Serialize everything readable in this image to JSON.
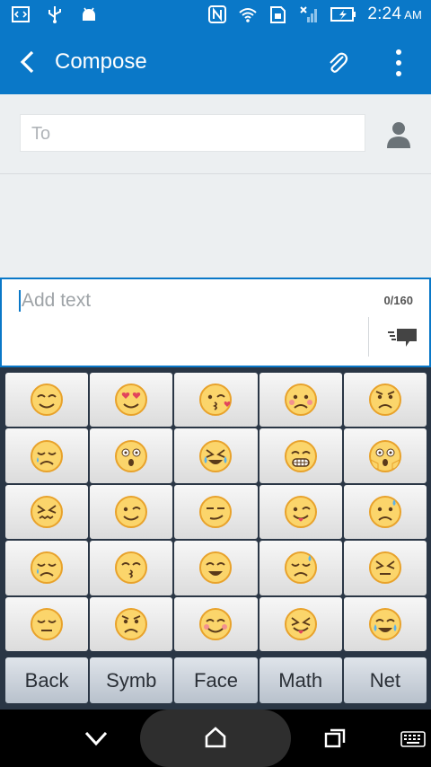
{
  "status_bar": {
    "time": "2:24",
    "ampm": "AM"
  },
  "app_bar": {
    "title": "Compose"
  },
  "to_field": {
    "placeholder": "To"
  },
  "message": {
    "placeholder": "Add text",
    "counter": "0/160"
  },
  "emoji_names": [
    "smiling-face",
    "heart-eyes-face",
    "kissing-heart-face",
    "flushed-worried-face",
    "angry-face",
    "sad-tear-face",
    "surprised-face",
    "crying-face",
    "grinning-teeth-face",
    "screaming-face",
    "confounded-face",
    "winking-face",
    "smirking-face",
    "wink-tongue-face",
    "worried-face",
    "disappointed-relieved-face",
    "kissing-face",
    "smiling-open-mouth-face",
    "sad-sweat-face",
    "persevering-face",
    "pensive-face",
    "pouting-face",
    "blushing-smile-face",
    "squinting-tongue-face",
    "tears-of-joy-face"
  ],
  "keyboard_tabs": [
    "Back",
    "Symb",
    "Face",
    "Math",
    "Net"
  ],
  "colors": {
    "accent": "#0a78c8",
    "emoji_fill": "#fbd56b",
    "emoji_stroke": "#e8a22b"
  }
}
